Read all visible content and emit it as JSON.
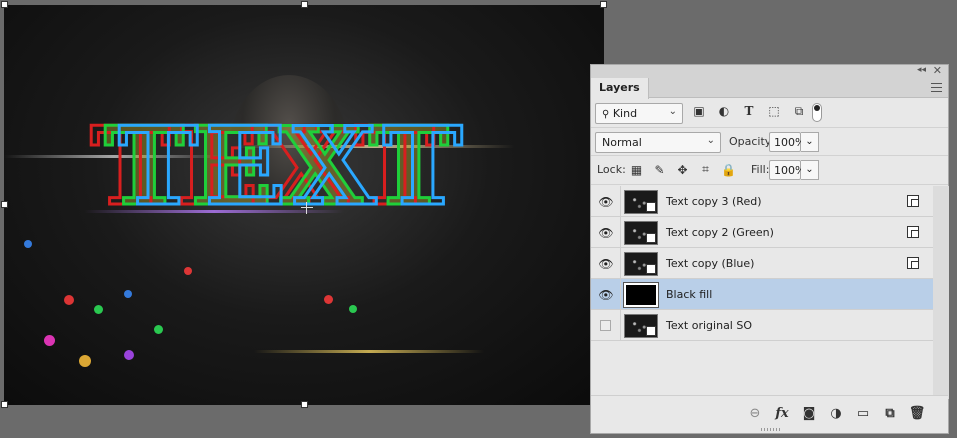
{
  "canvas": {
    "art_text": "TEXT"
  },
  "panel": {
    "tab_title": "Layers",
    "collapse_glyph": "◂◂",
    "close_glyph": "✕",
    "filter": {
      "kind_label": "Kind",
      "icons": [
        "image-filter-icon",
        "adjustment-filter-icon",
        "type-filter-icon",
        "shape-filter-icon",
        "smart-object-filter-icon"
      ]
    },
    "blend": {
      "mode": "Normal",
      "opacity_label": "Opacity:",
      "opacity_value": "100%"
    },
    "lock": {
      "label": "Lock:",
      "fill_label": "Fill:",
      "fill_value": "100%"
    },
    "layers": [
      {
        "name": "Text copy 3 (Red)",
        "visible": true,
        "selected": false
      },
      {
        "name": "Text copy 2 (Green)",
        "visible": true,
        "selected": false
      },
      {
        "name": "Text copy (Blue)",
        "visible": true,
        "selected": false
      },
      {
        "name": "Black fill",
        "visible": true,
        "selected": true
      },
      {
        "name": "Text original SO",
        "visible": false,
        "selected": false
      }
    ],
    "footer_icons": [
      "link-layers-icon",
      "fx-icon",
      "add-mask-icon",
      "new-adjustment-icon",
      "new-group-icon",
      "new-layer-icon",
      "delete-layer-icon"
    ]
  },
  "colors": {
    "selected_row": "#b9cfe8",
    "red": "#d81f1f",
    "green": "#1fcf3a",
    "blue": "#2aa8ff"
  }
}
